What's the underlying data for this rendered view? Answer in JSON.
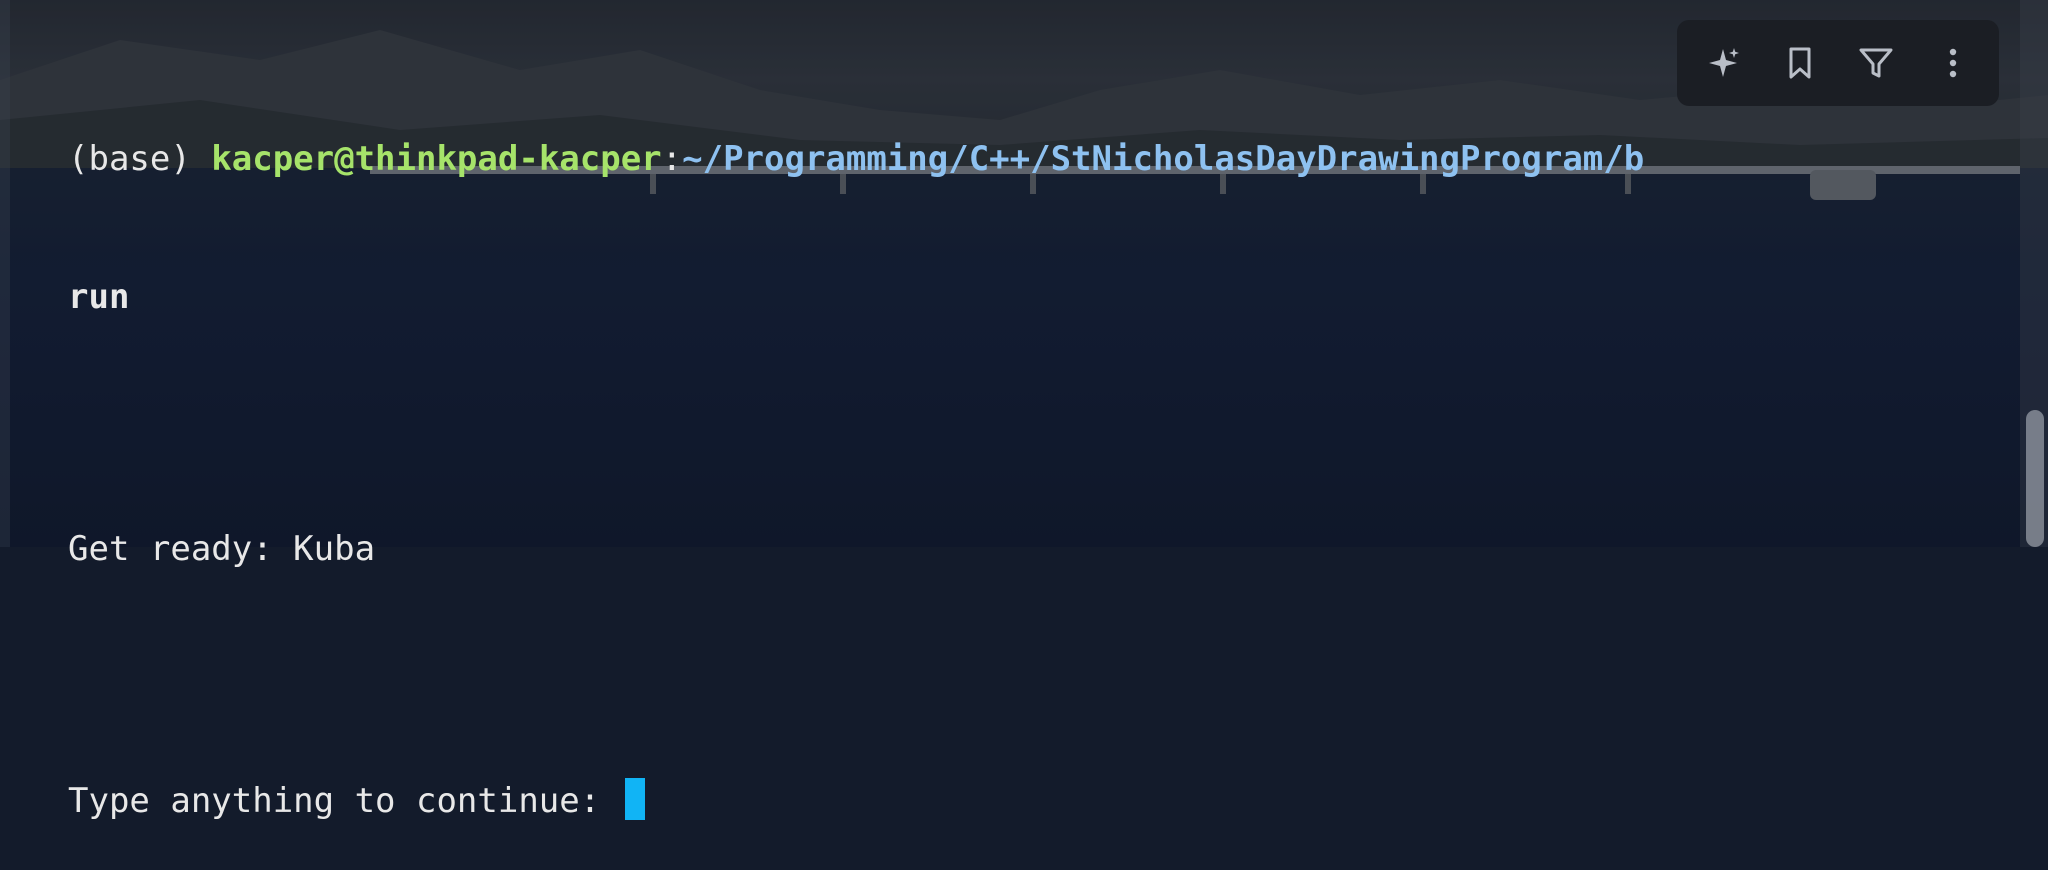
{
  "terminal": {
    "prompt_env": "(base) ",
    "prompt_user": "kacper@thinkpad-kacper",
    "prompt_sep": ":",
    "prompt_path": "~/Programming/C++/StNicholasDayDrawingProgram/b",
    "command_wrap": "run",
    "output_line": "Get ready: Kuba",
    "input_prompt": "Type anything to continue: "
  },
  "toolbar": {
    "icons": [
      "sparkle-icon",
      "bookmark-icon",
      "filter-icon",
      "more-vertical-icon"
    ]
  },
  "colors": {
    "user": "#a6e36a",
    "path": "#8ec1f0",
    "cursor": "#11b4f5",
    "text": "#e8e8e8"
  }
}
